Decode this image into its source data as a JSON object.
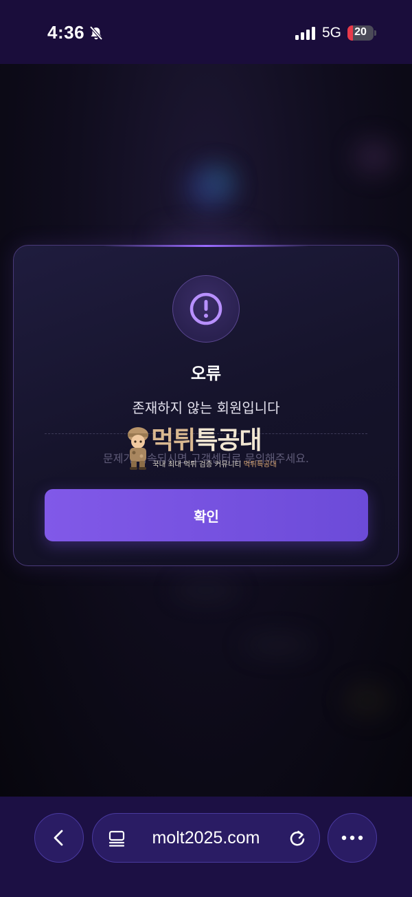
{
  "status_bar": {
    "time": "4:36",
    "network": "5G",
    "battery": "20",
    "battery_level": 0.2
  },
  "dialog": {
    "icon": "exclamation-circle-icon",
    "title": "오류",
    "message": "존재하지 않는 회원입니다",
    "hint": "문제가 지속되시면 고객센터로 문의해주세요.",
    "confirm_label": "확인",
    "accent_color": "#8159e8"
  },
  "watermark": {
    "title_a": "먹튀",
    "title_b": "특공대",
    "subtitle": "국내 최대 먹튀 검증 커뮤니티",
    "subtitle_accent": "먹튀특공대"
  },
  "browser": {
    "url": "molt2025.com",
    "back_icon": "chevron-left-icon",
    "tabs_icon": "tabs-icon",
    "reload_icon": "reload-icon",
    "more_icon": "more-horizontal-icon",
    "bar_color": "#1c1044"
  }
}
